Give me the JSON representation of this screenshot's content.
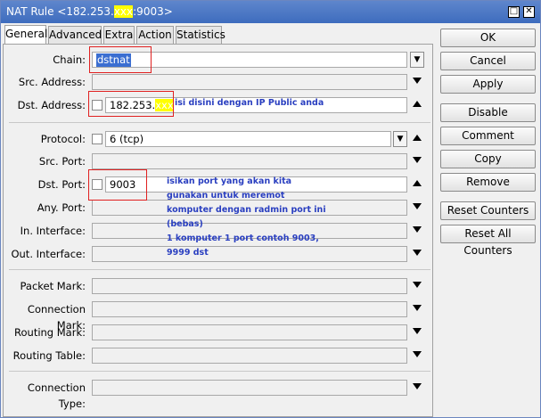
{
  "window": {
    "title_prefix": "NAT Rule <182.253.",
    "title_hidden": "xxx",
    "title_suffix": ":9003>",
    "maximize_label": "□",
    "close_label": "✕"
  },
  "tabs": [
    {
      "label": "General"
    },
    {
      "label": "Advanced"
    },
    {
      "label": "Extra"
    },
    {
      "label": "Action"
    },
    {
      "label": "Statistics"
    }
  ],
  "fields": {
    "chain": {
      "label": "Chain:",
      "value": "dstnat"
    },
    "src_address": {
      "label": "Src. Address:",
      "value": ""
    },
    "dst_address": {
      "label": "Dst. Address:",
      "value": "182.253.",
      "hidden": "xxx"
    },
    "protocol": {
      "label": "Protocol:",
      "value": "6 (tcp)"
    },
    "src_port": {
      "label": "Src. Port:",
      "value": ""
    },
    "dst_port": {
      "label": "Dst. Port:",
      "value": "9003"
    },
    "any_port": {
      "label": "Any. Port:",
      "value": ""
    },
    "in_interface": {
      "label": "In. Interface:",
      "value": ""
    },
    "out_interface": {
      "label": "Out. Interface:",
      "value": ""
    },
    "packet_mark": {
      "label": "Packet Mark:",
      "value": ""
    },
    "connection_mark": {
      "label": "Connection Mark:",
      "value": ""
    },
    "routing_mark": {
      "label": "Routing Mark:",
      "value": ""
    },
    "routing_table": {
      "label": "Routing Table:",
      "value": ""
    },
    "connection_type": {
      "label": "Connection Type:",
      "value": ""
    }
  },
  "annotations": {
    "dst_address_note": "isi disini  dengan IP Public anda",
    "dst_port_note": [
      "isikan port yang akan kita",
      "gunakan untuk meremot",
      "komputer dengan radmin port ini",
      "(bebas)",
      "1 komputer 1 port contoh 9003,",
      "9999 dst"
    ]
  },
  "buttons": {
    "ok": "OK",
    "cancel": "Cancel",
    "apply": "Apply",
    "disable": "Disable",
    "comment": "Comment",
    "copy": "Copy",
    "remove": "Remove",
    "reset_counters": "Reset Counters",
    "reset_all_counters": "Reset All Counters"
  },
  "colors": {
    "titlebar": "#4a76c4",
    "annotation_box": "#e02020",
    "annotation_text": "#2a3fc0",
    "redaction": "#ffff00",
    "selection": "#3b6ed1"
  }
}
